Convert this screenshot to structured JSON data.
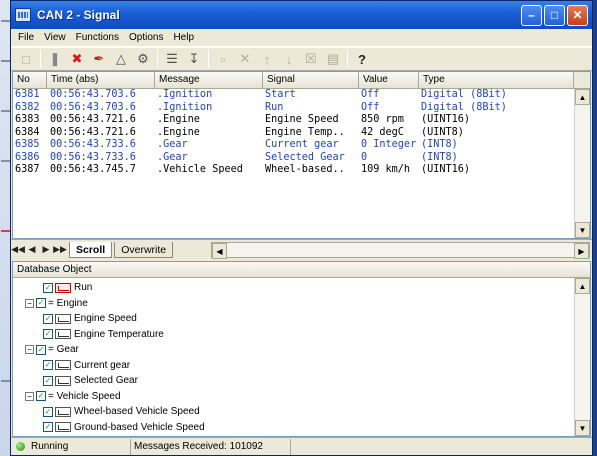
{
  "window": {
    "title": "CAN 2 - Signal"
  },
  "menu": [
    "File",
    "View",
    "Functions",
    "Options",
    "Help"
  ],
  "toolbar": {
    "icons": [
      "new-icon",
      "pause-icon",
      "stop-icon",
      "pen-icon",
      "filter-icon",
      "settings-icon",
      "signal-config-icon",
      "export-icon",
      "copy-icon",
      "delete-icon",
      "move-up-icon",
      "move-down-icon",
      "clear-icon",
      "window-icon",
      "help-icon"
    ]
  },
  "grid": {
    "columns": [
      "No",
      "Time (abs)",
      "Message",
      "Signal",
      "Value",
      "Type"
    ],
    "rows": [
      {
        "no": "6381",
        "time": "00:56:43.703.6",
        "msg": ".Ignition",
        "sig": "Start",
        "val": "Off",
        "type": "Digital (8Bit)",
        "highlight": true
      },
      {
        "no": "6382",
        "time": "00:56:43.703.6",
        "msg": ".Ignition",
        "sig": "Run",
        "val": "Off",
        "type": "Digital (8Bit)",
        "highlight": true
      },
      {
        "no": "6383",
        "time": "00:56:43.721.6",
        "msg": ".Engine",
        "sig": "Engine Speed",
        "val": "850 rpm",
        "type": "(UINT16)",
        "highlight": false
      },
      {
        "no": "6384",
        "time": "00:56:43.721.6",
        "msg": ".Engine",
        "sig": "Engine Temp..",
        "val": "42 degC",
        "type": "(UINT8)",
        "highlight": false
      },
      {
        "no": "6385",
        "time": "00:56:43.733.6",
        "msg": ".Gear",
        "sig": "Current gear",
        "val": "0 Integer",
        "type": "(INT8)",
        "highlight": true
      },
      {
        "no": "6386",
        "time": "00:56:43.733.6",
        "msg": ".Gear",
        "sig": "Selected Gear",
        "val": "0",
        "type": "(INT8)",
        "highlight": true
      },
      {
        "no": "6387",
        "time": "00:56:43.745.7",
        "msg": ".Vehicle Speed",
        "sig": "Wheel-based..",
        "val": "109 km/h",
        "type": "(UINT16)",
        "highlight": false
      }
    ]
  },
  "tabs": {
    "active": "Scroll",
    "inactive": "Overwrite"
  },
  "database": {
    "header": "Database Object",
    "tree": [
      {
        "level": 2,
        "label": "Run",
        "kind": "signal-red"
      },
      {
        "level": 1,
        "label": "= Engine",
        "kind": "group"
      },
      {
        "level": 2,
        "label": "Engine Speed",
        "kind": "signal"
      },
      {
        "level": 2,
        "label": "Engine Temperature",
        "kind": "signal"
      },
      {
        "level": 1,
        "label": "= Gear",
        "kind": "group"
      },
      {
        "level": 2,
        "label": "Current gear",
        "kind": "signal"
      },
      {
        "level": 2,
        "label": "Selected Gear",
        "kind": "signal"
      },
      {
        "level": 1,
        "label": "= Vehicle Speed",
        "kind": "group"
      },
      {
        "level": 2,
        "label": "Wheel-based Vehicle Speed",
        "kind": "signal"
      },
      {
        "level": 2,
        "label": "Ground-based Vehicle Speed",
        "kind": "signal"
      }
    ]
  },
  "status": {
    "state": "Running",
    "messages": "Messages Received: 101092"
  }
}
